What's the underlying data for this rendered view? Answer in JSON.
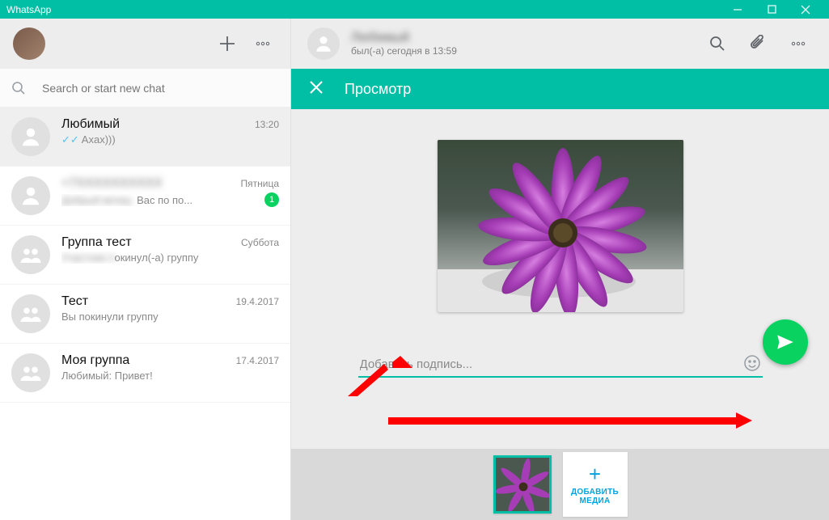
{
  "window": {
    "title": "WhatsApp"
  },
  "sidebar": {
    "search_placeholder": "Search or start new chat",
    "chats": [
      {
        "name": "Любимый",
        "time": "13:20",
        "preview": "Axax)))",
        "ticks": true,
        "badge": null,
        "name_blur": false,
        "preview_prefix_blur": false
      },
      {
        "name": "+7XXXXXXXXXX",
        "time": "Пятница",
        "preview_suffix": "Вас по по...",
        "preview_prefix": "Добрый вечер,",
        "ticks": false,
        "badge": "1",
        "name_blur": true,
        "preview_prefix_blur": true
      },
      {
        "name": "Группа тест",
        "time": "Суббота",
        "preview_suffix": "окинул(-а) группу",
        "preview_prefix": "Участник п",
        "ticks": false,
        "badge": null,
        "name_blur": false,
        "preview_prefix_blur": true
      },
      {
        "name": "Тест",
        "time": "19.4.2017",
        "preview": "Вы покинули группу",
        "ticks": false,
        "badge": null,
        "name_blur": false,
        "preview_prefix_blur": false
      },
      {
        "name": "Моя группа",
        "time": "17.4.2017",
        "preview": "Любимый: Привет!",
        "ticks": false,
        "badge": null,
        "name_blur": false,
        "preview_prefix_blur": false
      }
    ]
  },
  "conversation": {
    "contact_name": "Любимый",
    "status": "был(-а) сегодня в 13:59"
  },
  "preview_panel": {
    "title": "Просмотр",
    "caption_placeholder": "Добавить подпись...",
    "add_media_label": "ДОБАВИТЬ МЕДИА"
  }
}
